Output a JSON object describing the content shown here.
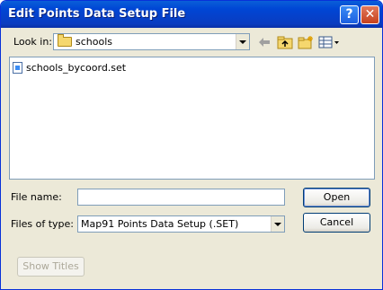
{
  "window": {
    "title": "Edit Points Data Setup File",
    "help_glyph": "?",
    "close_glyph": "✕"
  },
  "lookin": {
    "label": "Look in:",
    "value": "schools"
  },
  "toolbar": {
    "icons": [
      "back-arrow-icon",
      "up-folder-icon",
      "new-folder-icon",
      "view-menu-icon"
    ]
  },
  "files": [
    {
      "name": "schools_bycoord.set",
      "icon": "set-file-icon"
    }
  ],
  "filename": {
    "label": "File name:",
    "value": ""
  },
  "filetype": {
    "label": "Files of type:",
    "value": "Map91 Points Data Setup (.SET)"
  },
  "buttons": {
    "open": "Open",
    "cancel": "Cancel",
    "show_titles": "Show Titles"
  }
}
